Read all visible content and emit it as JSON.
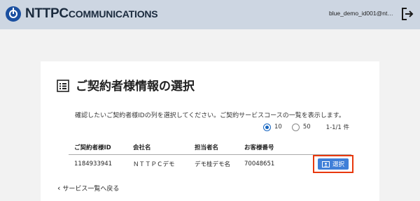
{
  "header": {
    "logo_text_main": "NTT",
    "logo_text_sub": "PC",
    "logo_text_tail": "COMMUNICATIONS",
    "user_id": "blue_demo_id001@nt…"
  },
  "main": {
    "title": "ご契約者様情報の選択",
    "description": "確認したいご契約者様IDの列を選択してください。ご契約サービスコースの一覧を表示します。",
    "page_size_options": [
      {
        "label": "10",
        "selected": true
      },
      {
        "label": "50",
        "selected": false
      }
    ],
    "result_count": "1-1/1 件",
    "table": {
      "headers": [
        "ご契約者様ID",
        "会社名",
        "担当者名",
        "お客様番号"
      ],
      "rows": [
        {
          "contract_id": "1184933941",
          "company": "ＮＴＴＰＣデモ",
          "contact": "デモ桂デモ名",
          "customer_no": "70048651",
          "action": "選択"
        }
      ]
    },
    "back_link": "サービス一覧へ戻る"
  },
  "colors": {
    "header_bg": "#cdd6e2",
    "accent_blue": "#3f7fd8",
    "highlight_red": "#e8380d"
  }
}
